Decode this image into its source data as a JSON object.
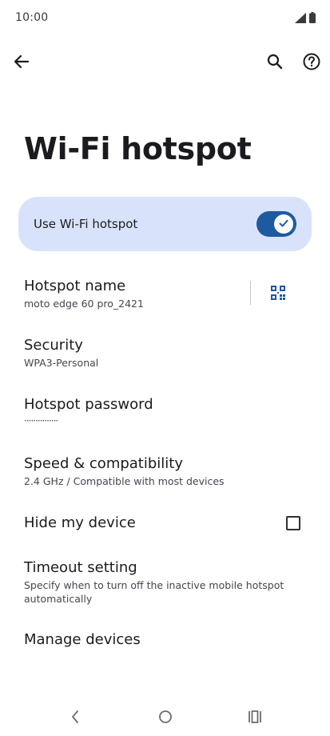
{
  "status_bar": {
    "time": "10:00",
    "icons": [
      "signal-icon",
      "battery-icon"
    ]
  },
  "app_bar": {
    "back_icon": "arrow-back-icon",
    "search_icon": "search-icon",
    "help_icon": "help-icon"
  },
  "page": {
    "title": "Wi-Fi hotspot"
  },
  "main_toggle": {
    "label": "Use Wi-Fi hotspot",
    "on": true,
    "card_color": "#d8e3fb",
    "switch_color": "#1e5aa0"
  },
  "settings": {
    "hotspot_name": {
      "title": "Hotspot name",
      "summary": "moto edge 60 pro_2421",
      "action_icon": "qr-code-icon"
    },
    "security": {
      "title": "Security",
      "summary": "WPA3-Personal"
    },
    "hotspot_password": {
      "title": "Hotspot password",
      "summary": "···············"
    },
    "speed": {
      "title": "Speed & compatibility",
      "summary": "2.4 GHz / Compatible with most devices"
    },
    "hide_device": {
      "title": "Hide my device",
      "checked": false
    },
    "timeout": {
      "title": "Timeout setting",
      "summary": "Specify when to turn off the inactive mobile hotspot automatically"
    },
    "manage_devices": {
      "title": "Manage devices"
    }
  },
  "nav_bar": {
    "back_icon": "nav-back-icon",
    "home_icon": "nav-home-icon",
    "recents_icon": "nav-recents-icon"
  }
}
